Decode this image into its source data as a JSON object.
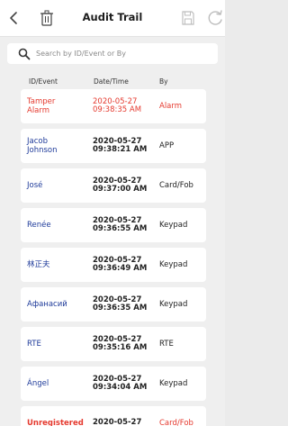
{
  "header": {
    "title": "Audit Trail",
    "icons": [
      "back-icon",
      "trash-icon",
      "save-icon",
      "refresh-icon"
    ]
  },
  "search": {
    "placeholder": "Search by ID/Event or By"
  },
  "columns": {
    "id_event": "ID/Event",
    "date_time": "Date/Time",
    "by": "By"
  },
  "colors": {
    "alarm": "#e53a2f",
    "name": "#1f3b9a",
    "background": "#efefef"
  },
  "rows": [
    {
      "id": "Tamper\nAlarm",
      "date": "2020-05-27",
      "time": "09:38:35 AM",
      "by": "Alarm",
      "type": "alarm"
    },
    {
      "id": "Jacob\nJohnson",
      "date": "2020-05-27",
      "time": "09:38:21 AM",
      "by": "APP",
      "type": "name"
    },
    {
      "id": "José",
      "date": "2020-05-27",
      "time": "09:37:00 AM",
      "by": "Card/Fob",
      "type": "name"
    },
    {
      "id": "Renée",
      "date": "2020-05-27",
      "time": "09:36:55 AM",
      "by": "Keypad",
      "type": "name"
    },
    {
      "id": "林正夫",
      "date": "2020-05-27",
      "time": "09:36:49 AM",
      "by": "Keypad",
      "type": "name"
    },
    {
      "id": "Афанасий",
      "date": "2020-05-27",
      "time": "09:36:35 AM",
      "by": "Keypad",
      "type": "name"
    },
    {
      "id": "RTE",
      "date": "2020-05-27",
      "time": "09:35:16 AM",
      "by": "RTE",
      "type": "name"
    },
    {
      "id": "Ángel",
      "date": "2020-05-27",
      "time": "09:34:04 AM",
      "by": "Keypad",
      "type": "name"
    },
    {
      "id": "Unregistered",
      "date": "2020-05-27",
      "time": "",
      "by": "Card/Fob",
      "type": "unreg"
    }
  ]
}
